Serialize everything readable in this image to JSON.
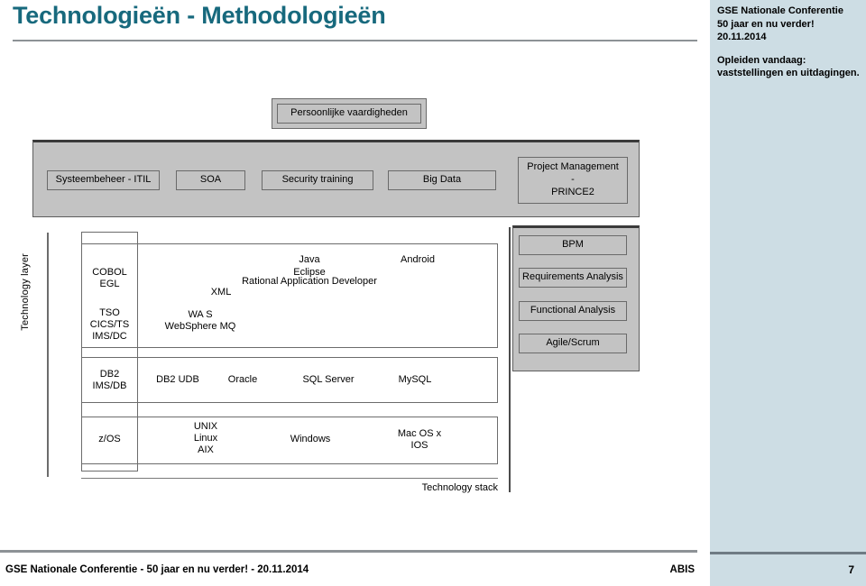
{
  "slide": {
    "title": "Technologieën - Methodologieën"
  },
  "conference_panel": {
    "line1": "GSE Nationale Conferentie",
    "line2": "50 jaar en nu verder!",
    "line3": "20.11.2014",
    "line4": "Opleiden vandaag:",
    "line5": "vaststellingen en uitdagingen.",
    "page_number": "7"
  },
  "footer": {
    "left": "GSE Nationale Conferentie -  50 jaar en nu verder! - 20.11.2014",
    "right": "ABIS"
  },
  "diagram": {
    "soft_skills_box": "Persoonlijke vaardigheden",
    "training_band": [
      {
        "label": "Systeembeheer - ITIL"
      },
      {
        "label": "SOA"
      },
      {
        "label": "Security training"
      },
      {
        "label": "Big Data"
      },
      {
        "label": "Project Management\n-\nPRINCE2"
      }
    ],
    "project_management_lines": [
      "Project Management",
      "-",
      "PRINCE2"
    ],
    "technology_layer_caption": "Technology layer",
    "technology_stack_caption": "Technology stack",
    "methodology_boxes": [
      {
        "label": "BPM"
      },
      {
        "label": "Requirements Analysis"
      },
      {
        "label": "Functional Analysis"
      },
      {
        "label": "Agile/Scrum"
      }
    ],
    "application_layer": {
      "platform_top": [
        "COBOL",
        "EGL"
      ],
      "platform_bottom": [
        "TSO",
        "CICS/TS",
        "IMS/DC"
      ],
      "items": [
        {
          "label": "Java"
        },
        {
          "label": "Android"
        },
        {
          "label": "Eclipse"
        },
        {
          "label": "Rational Application Developer"
        },
        {
          "label": "XML"
        },
        {
          "label": "WA S"
        },
        {
          "label": "WebSphere MQ"
        }
      ]
    },
    "database_layer": {
      "platform": [
        "DB2",
        "IMS/DB"
      ],
      "items": [
        {
          "label": "DB2 UDB"
        },
        {
          "label": "Oracle"
        },
        {
          "label": "SQL Server"
        },
        {
          "label": "MySQL"
        }
      ]
    },
    "os_layer": {
      "platform": [
        "z/OS"
      ],
      "items": [
        {
          "label": "UNIX\nLinux\nAIX"
        },
        {
          "label": "Windows"
        },
        {
          "label": "Mac OS x\nIOS"
        }
      ],
      "unix_lines": [
        "UNIX",
        "Linux",
        "AIX"
      ],
      "windows_label": "Windows",
      "mac_lines": [
        "Mac OS x",
        "IOS"
      ]
    }
  },
  "colors": {
    "title": "#17697d",
    "panel_blue": "#cddde4",
    "box_gray": "#c3c3c3",
    "rule_gray": "#8d9296"
  }
}
